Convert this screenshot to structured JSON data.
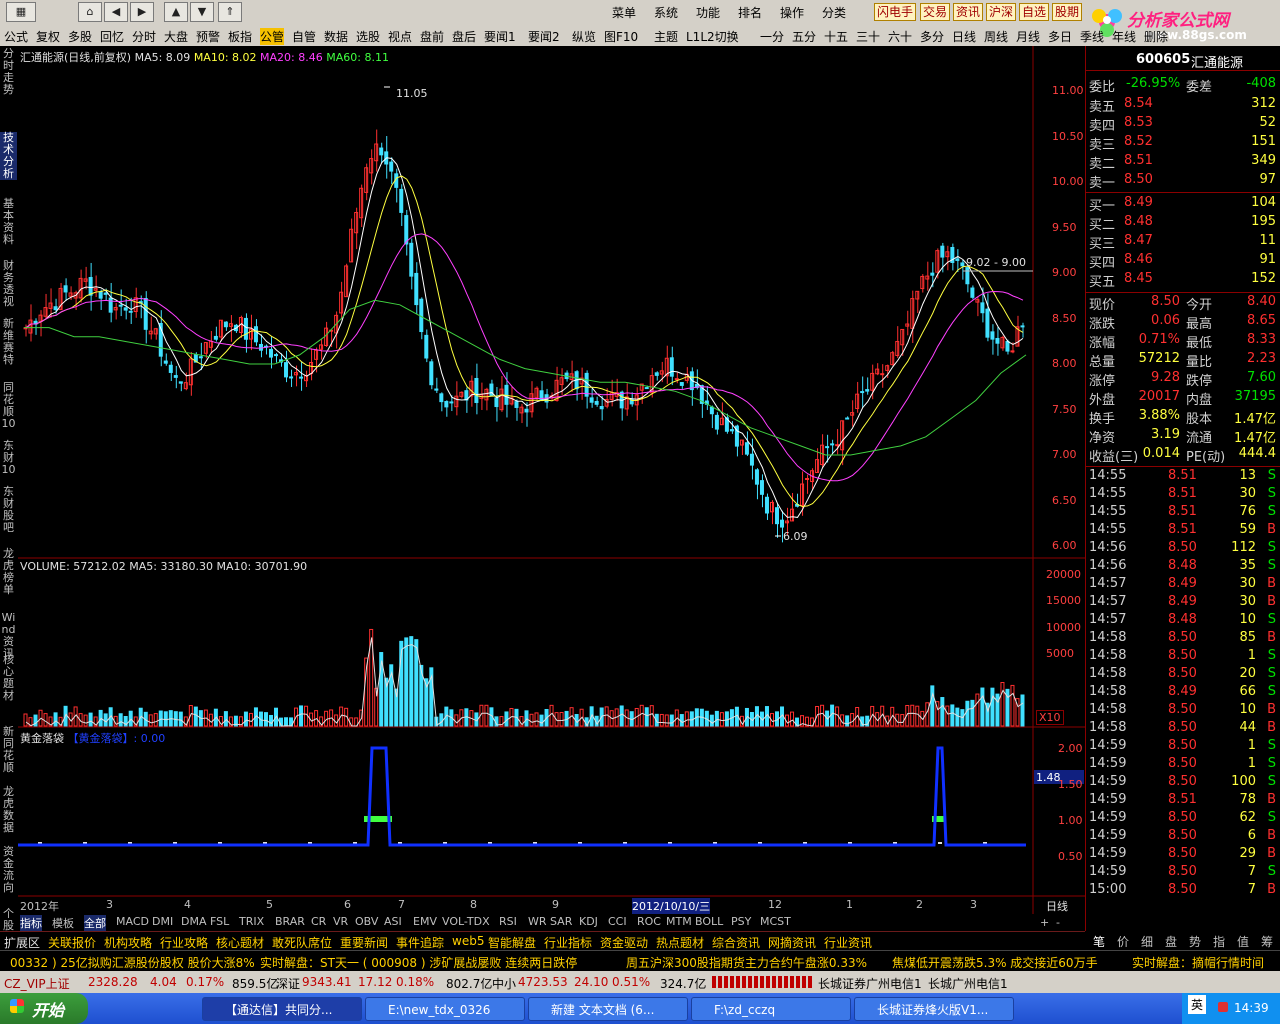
{
  "top": {
    "menus": [
      "菜单",
      "系统",
      "功能",
      "排名",
      "操作",
      "分类"
    ],
    "quick": [
      "闪电手",
      "交易",
      "资讯",
      "沪深",
      "自选",
      "股期"
    ],
    "logo": {
      "title": "分析家公式网",
      "url": "www.88gs.com"
    }
  },
  "toolbar": [
    "公式",
    "复权",
    "多股",
    "回忆",
    "分时",
    "大盘",
    "预警",
    "板指",
    "公管",
    "自管",
    "数据",
    "选股",
    "视点",
    "盘前",
    "盘后",
    "要闻1",
    "要闻2",
    "纵览",
    "图F10",
    "主题",
    "L1L2切换",
    "一分",
    "五分",
    "十五",
    "三十",
    "六十",
    "多分",
    "日线",
    "周线",
    "月线",
    "多日",
    "季线",
    "年线",
    "删除"
  ],
  "toolbar_active": "公管",
  "sidebar": [
    "分时走势",
    "技术分析",
    "基本资料",
    "财务透视",
    "新维赛特",
    "同花顺10",
    "东财10",
    "东财股吧",
    "龙虎榜单",
    "Wind资讯",
    "核心题材",
    "新同花顺",
    "龙虎数据",
    "资金流向",
    "个股"
  ],
  "main": {
    "title": "汇通能源(日线,前复权)",
    "ma5_label": "MA5: 8.09",
    "ma10_label": "MA10: 8.02",
    "ma20_label": "MA20: 8.46",
    "ma60_label": "MA60: 8.11",
    "high_marker": "11.05",
    "low_marker": "6.09",
    "range_marker": "9.02 - 9.00",
    "price_ticks": [
      "11.00",
      "10.50",
      "10.00",
      "9.50",
      "9.00",
      "8.50",
      "8.00",
      "7.50",
      "7.00",
      "6.50",
      "6.00"
    ],
    "volume_label": "VOLUME: 57212.02",
    "vol_ma5": "MA5: 33180.30",
    "vol_ma10": "MA10: 30701.90",
    "vol_ticks": [
      "20000",
      "15000",
      "10000",
      "5000"
    ],
    "vol_unit": "X10",
    "ind_title": "黄金落袋",
    "ind_sub": "【黄金落袋】: 0.00",
    "ind_ticks": [
      "2.00",
      "1.50",
      "1.00",
      "0.50"
    ],
    "ind_cursor": "1.48",
    "date_labels": [
      "2012年",
      "3",
      "4",
      "5",
      "6",
      "7",
      "8",
      "9",
      "2012/10/10/三",
      "12",
      "1",
      "2",
      "3"
    ],
    "period": "日线"
  },
  "chart_data": {
    "type": "candlestick",
    "title": "汇通能源(日线,前复权)",
    "ylim": [
      6.0,
      11.2
    ],
    "series": [
      {
        "name": "MA5",
        "value": 8.09
      },
      {
        "name": "MA10",
        "value": 8.02
      },
      {
        "name": "MA20",
        "value": 8.46
      },
      {
        "name": "MA60",
        "value": 8.11
      }
    ],
    "annotations": [
      {
        "label": "11.05"
      },
      {
        "label": "6.09"
      },
      {
        "label": "9.02 - 9.00"
      }
    ],
    "close_path": [
      8.4,
      8.6,
      8.7,
      8.8,
      8.9,
      8.8,
      8.6,
      8.7,
      8.5,
      8.2,
      7.8,
      7.9,
      8.2,
      8.4,
      8.5,
      8.3,
      8.2,
      8.0,
      7.9,
      8.0,
      8.2,
      8.6,
      9.5,
      10.3,
      10.4,
      9.8,
      8.8,
      8.0,
      7.6,
      7.6,
      7.7,
      7.7,
      7.6,
      7.5,
      7.6,
      7.7,
      7.8,
      7.8,
      7.7,
      7.6,
      7.6,
      7.7,
      7.9,
      8.0,
      7.9,
      7.8,
      7.5,
      7.3,
      7.1,
      6.8,
      6.4,
      6.3,
      6.6,
      6.9,
      7.1,
      7.3,
      7.6,
      7.8,
      8.0,
      8.3,
      8.8,
      9.1,
      9.2,
      9.0,
      8.6,
      8.3,
      8.1,
      8.5
    ],
    "ma60_path": [
      8.4,
      8.4,
      8.3,
      8.3,
      8.25,
      8.2,
      8.15,
      8.1,
      8.05,
      8.0,
      8.0,
      8.1,
      8.3,
      8.6,
      8.7,
      8.65,
      8.5,
      8.35,
      8.2,
      8.05,
      7.95,
      7.9,
      7.85,
      7.8,
      7.8,
      7.75,
      7.7,
      7.6,
      7.45,
      7.3,
      7.2,
      7.1,
      7.0,
      7.0,
      7.05,
      7.1,
      7.2,
      7.4,
      7.6,
      7.9,
      8.1
    ],
    "volume_ylim": [
      0,
      20000
    ],
    "volume": 57212.02,
    "indicator": {
      "name": "黄金落袋",
      "value": 0.0,
      "signals": [
        {
          "at": "2012-07",
          "level": 2.0
        },
        {
          "at": "2013-02",
          "level": 2.0
        }
      ]
    }
  },
  "quote": {
    "code": "600605",
    "name": "汇通能源",
    "weibi_label": "委比",
    "weibi": "-26.95%",
    "weicha_label": "委差",
    "weicha": "-408",
    "asks": [
      {
        "label": "卖五",
        "price": "8.54",
        "vol": "312"
      },
      {
        "label": "卖四",
        "price": "8.53",
        "vol": "52"
      },
      {
        "label": "卖三",
        "price": "8.52",
        "vol": "151"
      },
      {
        "label": "卖二",
        "price": "8.51",
        "vol": "349"
      },
      {
        "label": "卖一",
        "price": "8.50",
        "vol": "97"
      }
    ],
    "bids": [
      {
        "label": "买一",
        "price": "8.49",
        "vol": "104"
      },
      {
        "label": "买二",
        "price": "8.48",
        "vol": "195"
      },
      {
        "label": "买三",
        "price": "8.47",
        "vol": "11"
      },
      {
        "label": "买四",
        "price": "8.46",
        "vol": "91"
      },
      {
        "label": "买五",
        "price": "8.45",
        "vol": "152"
      }
    ],
    "stats": [
      {
        "l1": "现价",
        "v1": "8.50",
        "l2": "今开",
        "v2": "8.40"
      },
      {
        "l1": "涨跌",
        "v1": "0.06",
        "l2": "最高",
        "v2": "8.65"
      },
      {
        "l1": "涨幅",
        "v1": "0.71%",
        "l2": "最低",
        "v2": "8.33"
      },
      {
        "l1": "总量",
        "v1": "57212",
        "l2": "量比",
        "v2": "2.23"
      },
      {
        "l1": "涨停",
        "v1": "9.28",
        "l2": "跌停",
        "v2": "7.60"
      },
      {
        "l1": "外盘",
        "v1": "20017",
        "l2": "内盘",
        "v2": "37195"
      },
      {
        "l1": "换手",
        "v1": "3.88%",
        "l2": "股本",
        "v2": "1.47亿"
      },
      {
        "l1": "净资",
        "v1": "3.19",
        "l2": "流通",
        "v2": "1.47亿"
      },
      {
        "l1": "收益(三)",
        "v1": "0.014",
        "l2": "PE(动)",
        "v2": "444.4"
      }
    ],
    "ticks": [
      [
        "14:55",
        "8.51",
        "13",
        "S"
      ],
      [
        "14:55",
        "8.51",
        "30",
        "S"
      ],
      [
        "14:55",
        "8.51",
        "76",
        "S"
      ],
      [
        "14:55",
        "8.51",
        "59",
        "B"
      ],
      [
        "14:56",
        "8.50",
        "112",
        "S"
      ],
      [
        "14:56",
        "8.48",
        "35",
        "S"
      ],
      [
        "14:57",
        "8.49",
        "30",
        "B"
      ],
      [
        "14:57",
        "8.49",
        "30",
        "B"
      ],
      [
        "14:57",
        "8.48",
        "10",
        "S"
      ],
      [
        "14:58",
        "8.50",
        "85",
        "B"
      ],
      [
        "14:58",
        "8.50",
        "1",
        "S"
      ],
      [
        "14:58",
        "8.50",
        "20",
        "S"
      ],
      [
        "14:58",
        "8.49",
        "66",
        "S"
      ],
      [
        "14:58",
        "8.50",
        "10",
        "B"
      ],
      [
        "14:58",
        "8.50",
        "44",
        "B"
      ],
      [
        "14:59",
        "8.50",
        "1",
        "S"
      ],
      [
        "14:59",
        "8.50",
        "1",
        "S"
      ],
      [
        "14:59",
        "8.50",
        "100",
        "S"
      ],
      [
        "14:59",
        "8.51",
        "78",
        "B"
      ],
      [
        "14:59",
        "8.50",
        "62",
        "S"
      ],
      [
        "14:59",
        "8.50",
        "6",
        "B"
      ],
      [
        "14:59",
        "8.50",
        "29",
        "B"
      ],
      [
        "14:59",
        "8.50",
        "7",
        "S"
      ],
      [
        "15:00",
        "8.50",
        "7",
        "B"
      ]
    ],
    "right_tabs": [
      "笔",
      "价",
      "细",
      "盘",
      "势",
      "指",
      "值",
      "筹"
    ]
  },
  "bottom_tabs": [
    "指标",
    "模板",
    "全部",
    "MACD",
    "DMI",
    "DMA",
    "FSL",
    "TRIX",
    "BRAR",
    "CR",
    "VR",
    "OBV",
    "ASI",
    "EMV",
    "VOL-TDX",
    "RSI",
    "WR",
    "SAR",
    "KDJ",
    "CCI",
    "ROC",
    "MTM",
    "BOLL",
    "PSY",
    "MCST"
  ],
  "info_tabs": [
    "扩展区",
    "关联报价",
    "机构攻略",
    "行业攻略",
    "核心题材",
    "敢死队席位",
    "重要新闻",
    "事件追踪",
    "web5",
    "智能解盘",
    "行业指标",
    "资金驱动",
    "热点题材",
    "综合资讯",
    "网摘资讯",
    "行业资讯"
  ],
  "ticker": [
    "00332 ) 25亿拟购汇源股份股权 股价大涨8%",
    "实时解盘：ST天一 ( 000908 ) 涉矿展战屡败 连续两日跌停",
    "周五沪深300股指期货主力合约午盘涨0.33%",
    "焦煤低开震荡跌5.3% 成交接近60万手",
    "实时解盘：摘帽行情时间"
  ],
  "index": {
    "sh_label": "CZ_VIP上证",
    "sh": "2328.28",
    "sh_chg": "4.04",
    "sh_pct": "0.17%",
    "sh_amt": "859.5亿",
    "sz_label": "深证",
    "sz": "9343.41",
    "sz_chg": "17.12",
    "sz_pct": "0.18%",
    "sz_amt": "802.7亿",
    "zx_label": "中小",
    "zx": "4723.53",
    "zx_chg": "24.10",
    "zx_pct": "0.51%",
    "zx_amt": "324.7亿",
    "broker1": "长城证券广州电信1",
    "broker2": "长城广州电信1"
  },
  "taskbar": {
    "start": "开始",
    "tasks": [
      "【通达信】共同分...",
      "E:\\new_tdx_0326",
      "新建 文本文档 (6...",
      "F:\\zd_cczq",
      "长城证券烽火版V1..."
    ],
    "ime": "英",
    "time": "14:39"
  }
}
